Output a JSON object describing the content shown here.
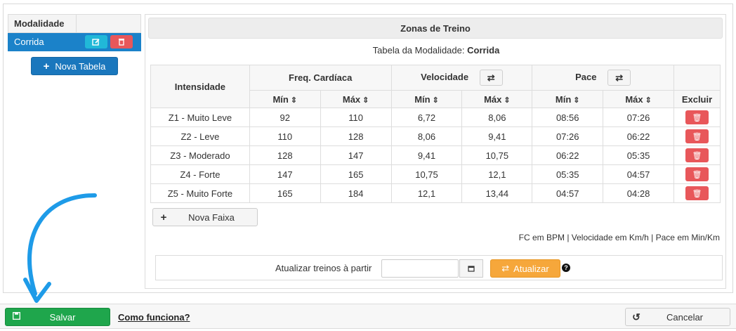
{
  "sidebar": {
    "header": "Modalidade",
    "items": [
      {
        "label": "Corrida"
      }
    ],
    "new_table_label": "Nova Tabela"
  },
  "zones": {
    "title": "Zonas de Treino",
    "subtitle_prefix": "Tabela da Modalidade:",
    "subtitle_value": "Corrida",
    "headers": {
      "intensity": "Intensidade",
      "heart_rate": "Freq. Cardíaca",
      "speed": "Velocidade",
      "pace": "Pace",
      "min": "Mín",
      "max": "Máx",
      "delete": "Excluir"
    },
    "rows": [
      {
        "name": "Z1 - Muito Leve",
        "hr_min": "92",
        "hr_max": "110",
        "sp_min": "6,72",
        "sp_max": "8,06",
        "pace_min": "08:56",
        "pace_max": "07:26"
      },
      {
        "name": "Z2 - Leve",
        "hr_min": "110",
        "hr_max": "128",
        "sp_min": "8,06",
        "sp_max": "9,41",
        "pace_min": "07:26",
        "pace_max": "06:22"
      },
      {
        "name": "Z3 - Moderado",
        "hr_min": "128",
        "hr_max": "147",
        "sp_min": "9,41",
        "sp_max": "10,75",
        "pace_min": "06:22",
        "pace_max": "05:35"
      },
      {
        "name": "Z4 - Forte",
        "hr_min": "147",
        "hr_max": "165",
        "sp_min": "10,75",
        "sp_max": "12,1",
        "pace_min": "05:35",
        "pace_max": "04:57"
      },
      {
        "name": "Z5 - Muito Forte",
        "hr_min": "165",
        "hr_max": "184",
        "sp_min": "12,1",
        "sp_max": "13,44",
        "pace_min": "04:57",
        "pace_max": "04:28"
      }
    ],
    "new_range_label": "Nova Faixa",
    "units_note": "FC em BPM | Velocidade em Km/h | Pace em Min/Km",
    "update_label": "Atualizar treinos à partir",
    "date_value": "",
    "update_button": "Atualizar"
  },
  "footer": {
    "save_label": "Salvar",
    "how_link": "Como funciona?",
    "cancel_label": "Cancelar"
  },
  "colors": {
    "primary": "#1a77bd",
    "selected": "#1b82c9",
    "danger": "#e8575a",
    "info": "#21b8d8",
    "warning": "#f6a73b",
    "success": "#1fa64c",
    "annotation_arrow": "#1e9be8"
  },
  "icons": {
    "edit": "edit-icon",
    "delete": "trash-icon",
    "swap": "swap-icon",
    "sort": "sort-icon",
    "calendar": "calendar-icon",
    "refresh": "refresh-icon",
    "help": "help-icon",
    "save": "floppy-icon",
    "cancel": "undo-icon",
    "plus": "plus-icon"
  }
}
